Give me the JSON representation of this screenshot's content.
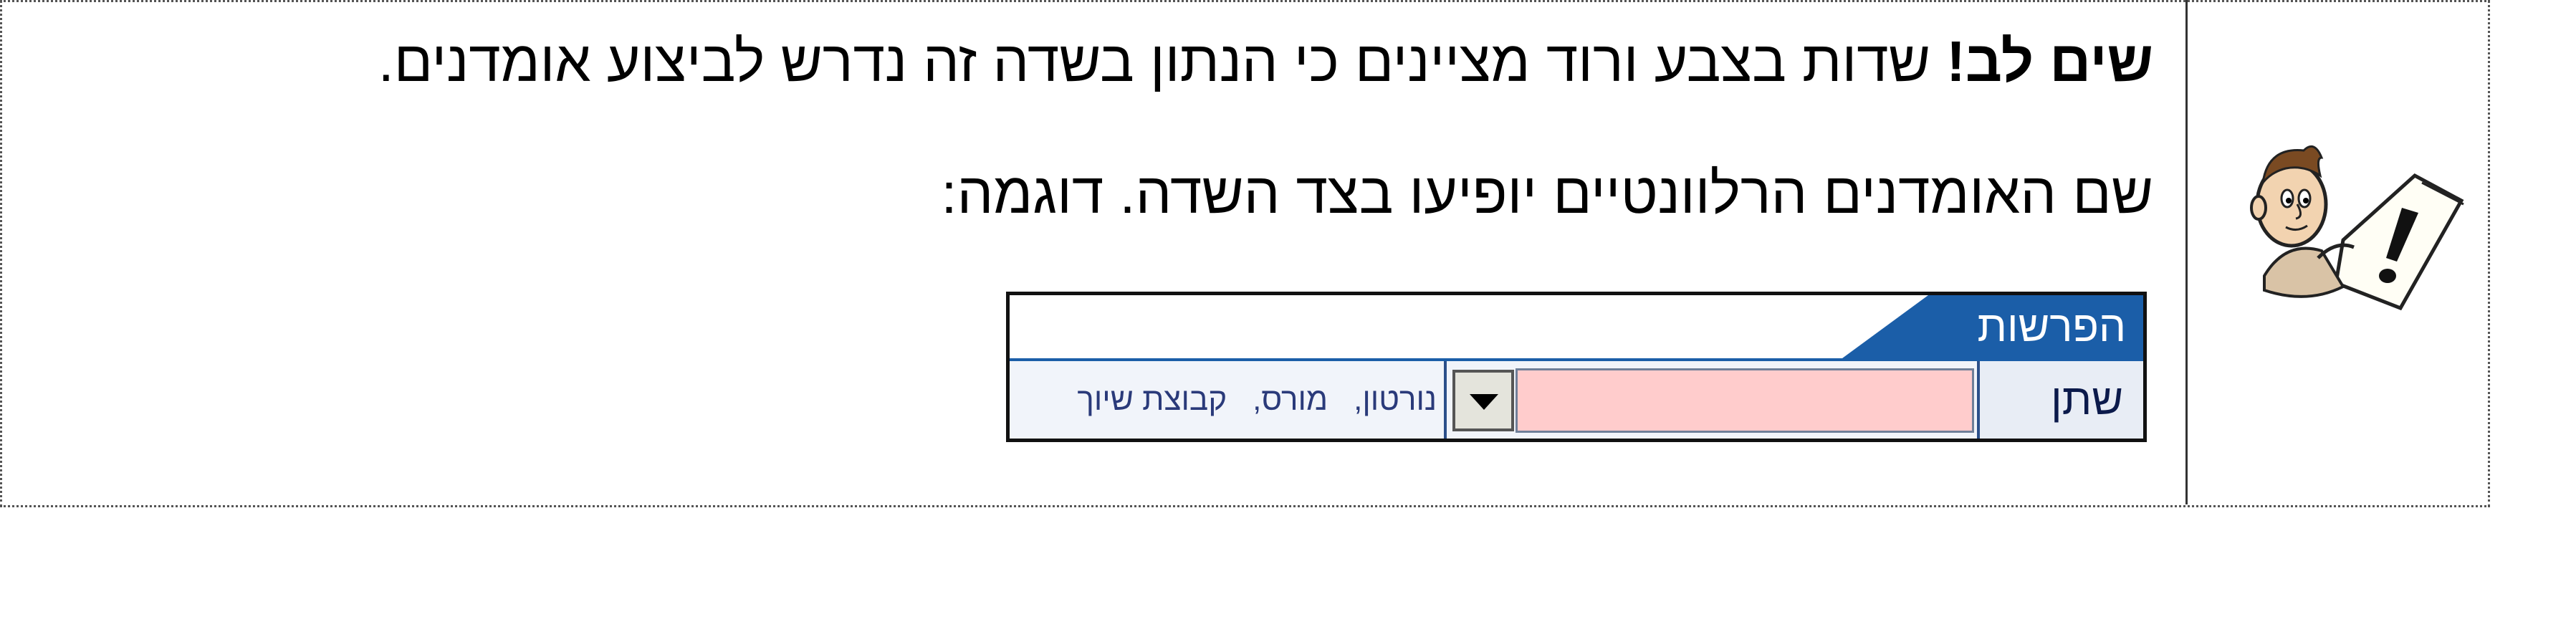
{
  "note": {
    "bold_prefix": "שים לב!",
    "line1_text": " שדות בצבע ורוד מציינים כי הנתון בשדה זה נדרש לביצוע אומדנים.",
    "line2_text": "שם האומדנים הרלוונטיים יופיעו בצד השדה. דוגמה:"
  },
  "icon": {
    "name": "cartoon-man-exclamation-icon"
  },
  "sample": {
    "header_title": "הפרשות",
    "field_label": "שתן",
    "groups": [
      "קבוצת שיוך",
      "מורס",
      "נורטון"
    ],
    "group_separator": ",",
    "colors": {
      "header_blue": "#1b5ea8",
      "required_pink": "#ffcccc"
    }
  }
}
